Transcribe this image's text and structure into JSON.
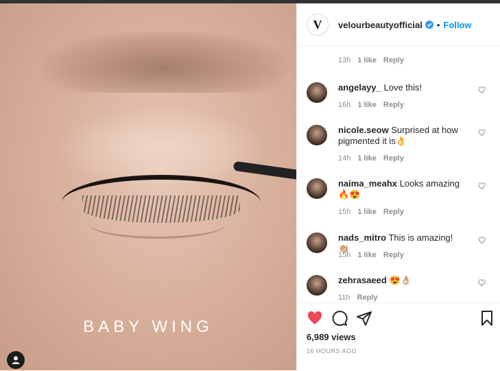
{
  "post": {
    "media_caption": "BABY WING"
  },
  "header": {
    "username": "velourbeautyofficial",
    "logo_letter": "V",
    "separator": "•",
    "follow_label": "Follow",
    "accent_color": "#0095f6"
  },
  "comments": {
    "partial_top": {
      "time": "13h",
      "likes": "1 like",
      "reply": "Reply"
    },
    "items": [
      {
        "username": "angelayy_",
        "text": "Love this!",
        "time": "16h",
        "likes": "1 like",
        "reply": "Reply"
      },
      {
        "username": "nicole.seow",
        "text": "Surprised at how pigmented it is👌",
        "time": "14h",
        "likes": "1 like",
        "reply": "Reply"
      },
      {
        "username": "naima_meahx",
        "text": "Looks amazing 🔥😍",
        "time": "15h",
        "likes": "1 like",
        "reply": "Reply"
      },
      {
        "username": "nads_mitro",
        "text": "This is amazing! 👏🏼",
        "time": "15h",
        "likes": "1 like",
        "reply": "Reply"
      },
      {
        "username": "zehrasaeed",
        "text": "😍👌🏼",
        "time": "11h",
        "likes": "",
        "reply": "Reply"
      }
    ]
  },
  "actions": {
    "views": "6,989 views",
    "timestamp": "16 HOURS AGO",
    "like_color": "#ed4956"
  }
}
